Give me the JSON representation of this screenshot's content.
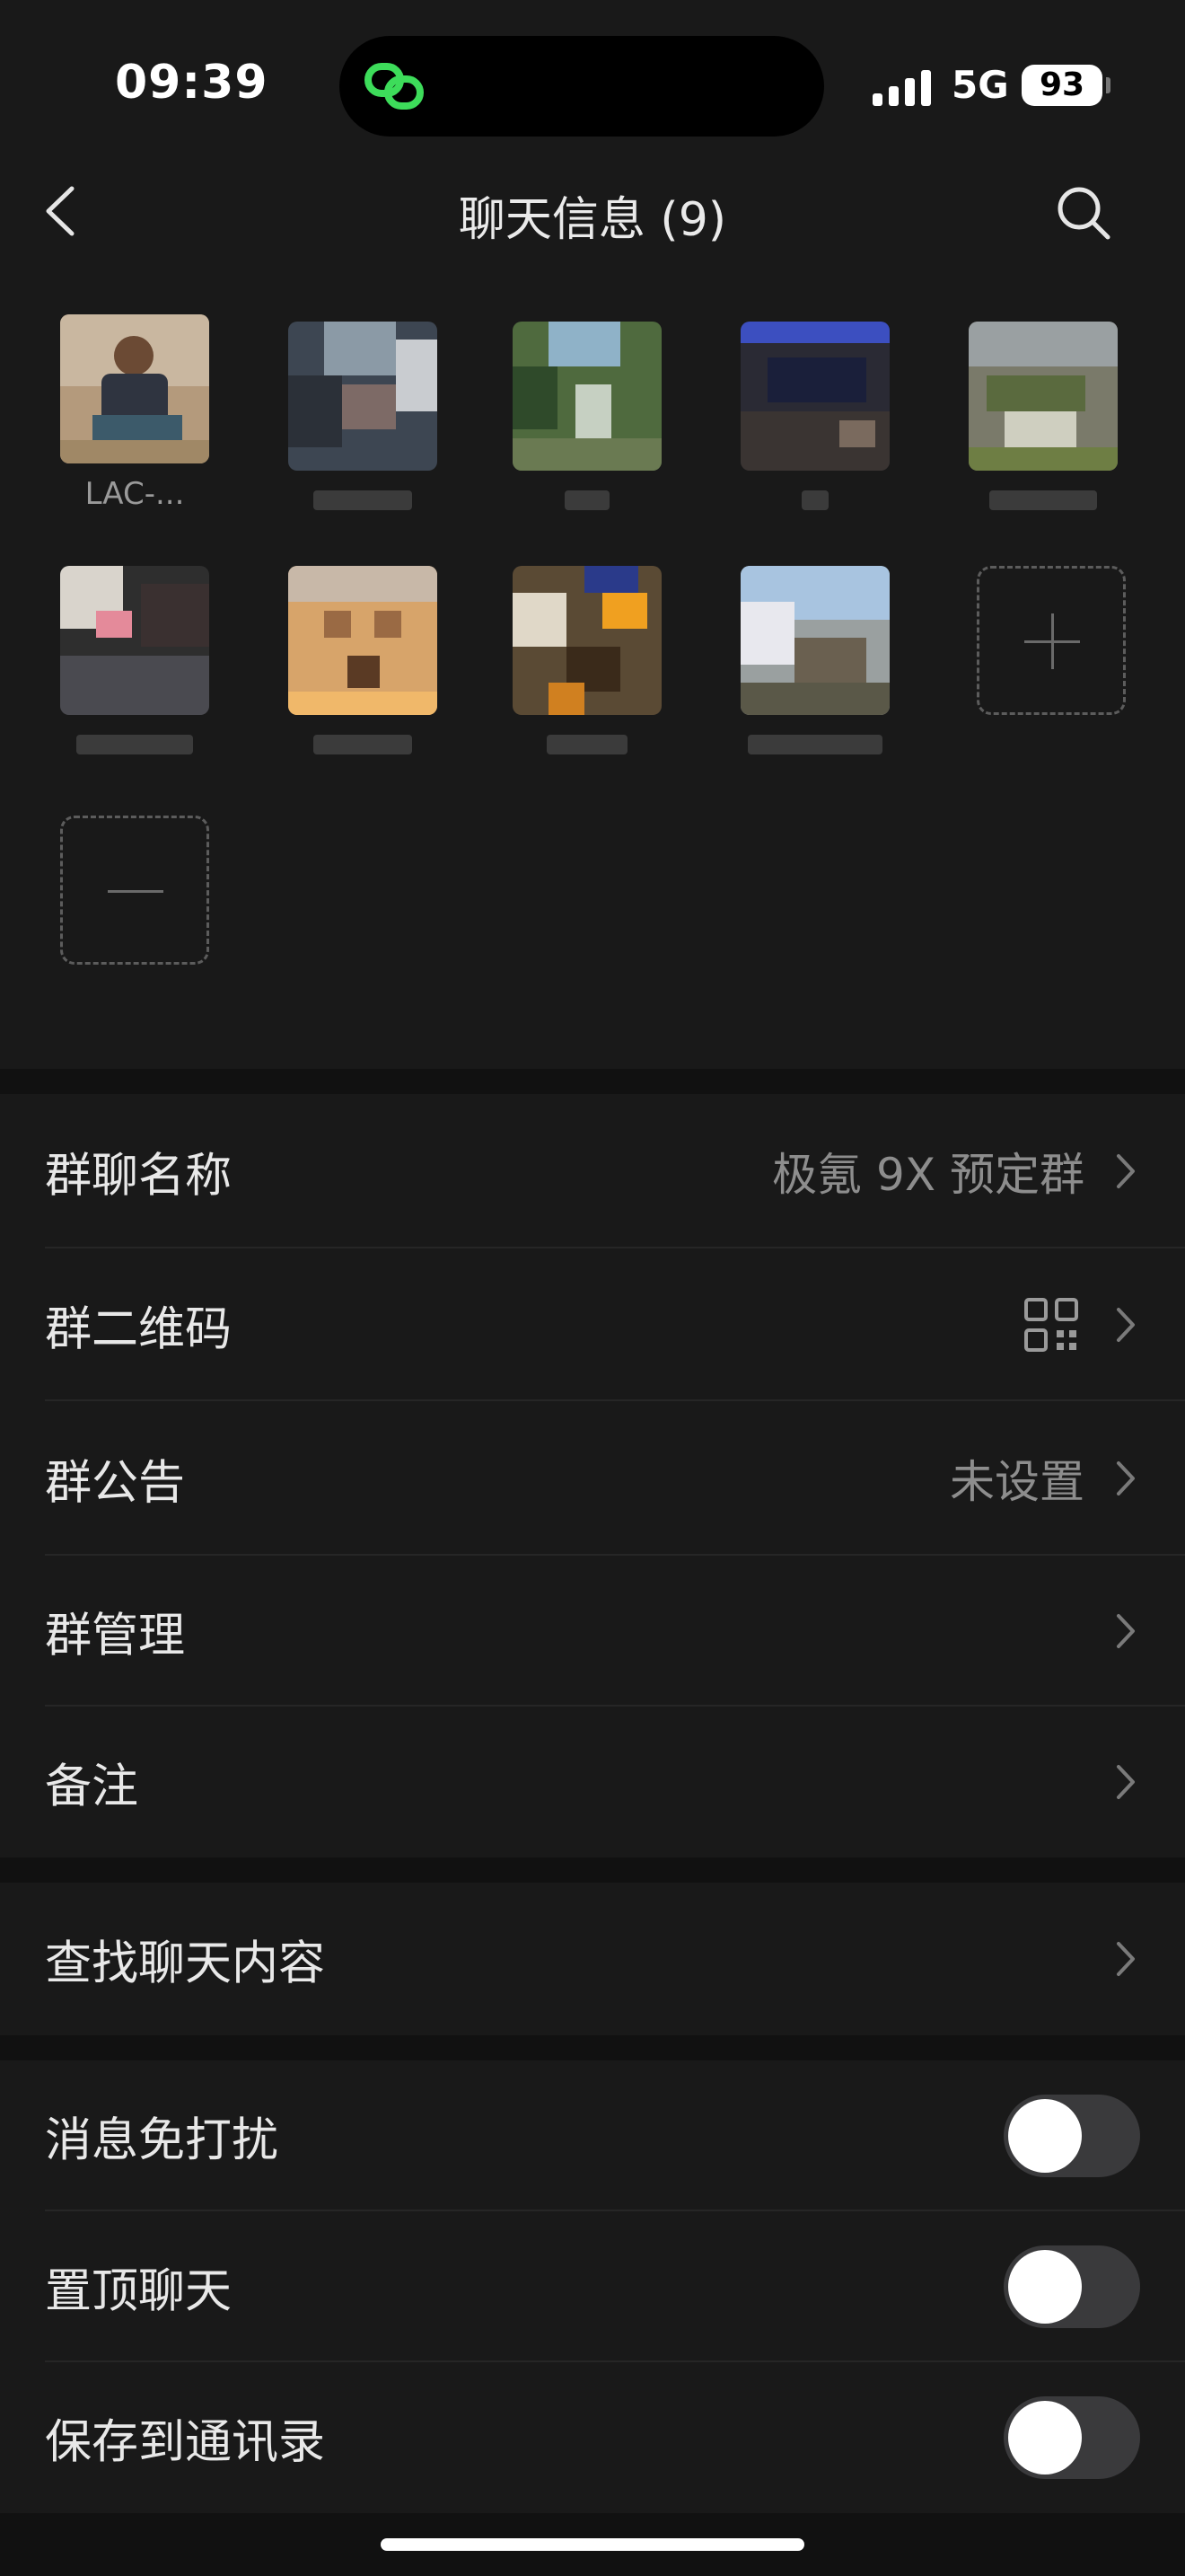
{
  "status": {
    "time": "09:39",
    "network": "5G",
    "battery": "93"
  },
  "nav": {
    "title": "聊天信息 (9)"
  },
  "members": [
    {
      "name": "LAC-..."
    },
    {
      "name": ""
    },
    {
      "name": ""
    },
    {
      "name": ""
    },
    {
      "name": ""
    },
    {
      "name": ""
    },
    {
      "name": ""
    },
    {
      "name": ""
    },
    {
      "name": ""
    }
  ],
  "settings": {
    "group_name": {
      "label": "群聊名称",
      "value": "极氪 9X 预定群"
    },
    "group_qr": {
      "label": "群二维码"
    },
    "announcement": {
      "label": "群公告",
      "value": "未设置"
    },
    "manage": {
      "label": "群管理"
    },
    "remark": {
      "label": "备注"
    },
    "search_history": {
      "label": "查找聊天内容"
    },
    "mute": {
      "label": "消息免打扰",
      "on": false
    },
    "pin": {
      "label": "置顶聊天",
      "on": false
    },
    "save_contacts": {
      "label": "保存到通讯录",
      "on": false
    }
  }
}
